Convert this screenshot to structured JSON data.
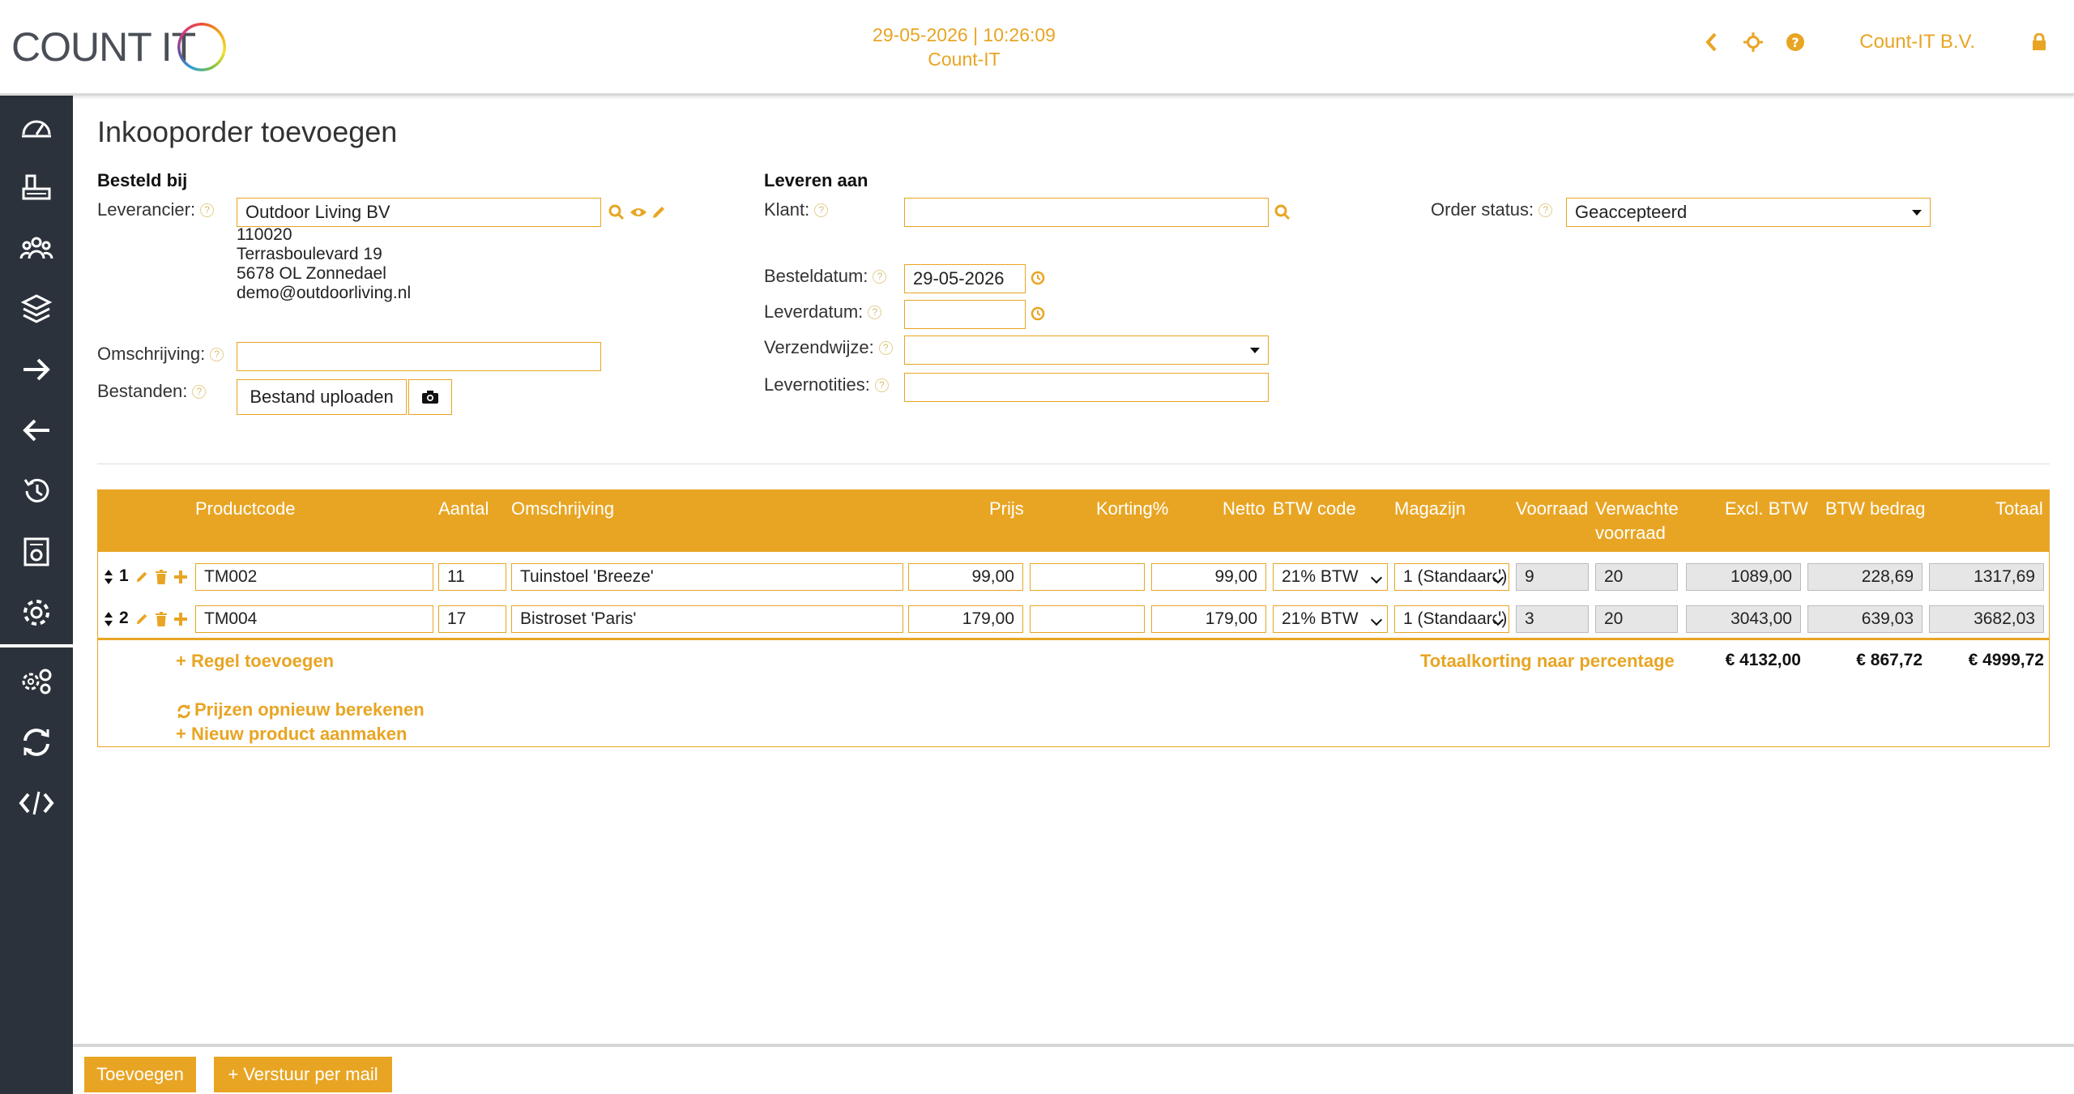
{
  "header": {
    "datetime": "29-05-2026 | 10:26:09",
    "app_name": "Count-IT",
    "company": "Count-IT B.V.",
    "logo_text": "COUNT IT"
  },
  "page": {
    "title": "Inkooporder toevoegen"
  },
  "supplier_section": {
    "title": "Besteld bij",
    "supplier_label": "Leverancier:",
    "supplier_value": "Outdoor Living BV",
    "address_lines": [
      "110020",
      "Terrasboulevard 19",
      "5678 OL Zonnedael",
      "demo@outdoorliving.nl"
    ],
    "description_label": "Omschrijving:",
    "description_value": "",
    "files_label": "Bestanden:",
    "upload_label": "Bestand uploaden"
  },
  "delivery_section": {
    "title": "Leveren aan",
    "customer_label": "Klant:",
    "customer_value": "",
    "order_date_label": "Besteldatum:",
    "order_date_value": "29-05-2026",
    "delivery_date_label": "Leverdatum:",
    "delivery_date_value": "",
    "shipping_label": "Verzendwijze:",
    "shipping_value": "",
    "notes_label": "Levernotities:",
    "notes_value": ""
  },
  "status": {
    "label": "Order status:",
    "value": "Geaccepteerd"
  },
  "table": {
    "headers": {
      "productcode": "Productcode",
      "aantal": "Aantal",
      "omschrijving": "Omschrijving",
      "prijs": "Prijs",
      "korting": "Korting%",
      "netto": "Netto",
      "btw_code": "BTW code",
      "magazijn": "Magazijn",
      "voorraad": "Voorraad",
      "verwachte_1": "Verwachte",
      "verwachte_2": "voorraad",
      "excl_btw": "Excl. BTW",
      "btw_bedrag": "BTW bedrag",
      "totaal": "Totaal"
    },
    "rows": [
      {
        "nr": "1",
        "productcode": "TM002",
        "aantal": "11",
        "omschrijving": "Tuinstoel 'Breeze'",
        "prijs": "99,00",
        "korting": "",
        "netto": "99,00",
        "btw_code": "21% BTW",
        "magazijn": "1 (Standaard)",
        "voorraad": "9",
        "verwacht": "20",
        "excl_btw": "1089,00",
        "btw_bedrag": "228,69",
        "totaal": "1317,69"
      },
      {
        "nr": "2",
        "productcode": "TM004",
        "aantal": "17",
        "omschrijving": "Bistroset 'Paris'",
        "prijs": "179,00",
        "korting": "",
        "netto": "179,00",
        "btw_code": "21% BTW",
        "magazijn": "1 (Standaard)",
        "voorraad": "3",
        "verwacht": "20",
        "excl_btw": "3043,00",
        "btw_bedrag": "639,03",
        "totaal": "3682,03"
      }
    ],
    "add_row_label": "+ Regel toevoegen",
    "discount_label": "Totaalkorting naar percentage",
    "total_excl": "€ 4132,00",
    "total_btw": "€ 867,72",
    "total_incl": "€ 4999,72",
    "recalc_label": "Prijzen opnieuw berekenen",
    "new_product_label": "+ Nieuw product aanmaken"
  },
  "footer": {
    "add_label": "Toevoegen",
    "mail_label": "+ Verstuur per mail"
  },
  "colors": {
    "accent": "#e8a523",
    "sidebar": "#2b323b"
  },
  "icons": [
    "dashboard-icon",
    "cashregister-icon",
    "users-icon",
    "layers-icon",
    "arrow-right-icon",
    "arrow-left-icon",
    "history-icon",
    "reports-icon",
    "gear-icon",
    "gears-icon",
    "sync-icon",
    "code-icon"
  ]
}
